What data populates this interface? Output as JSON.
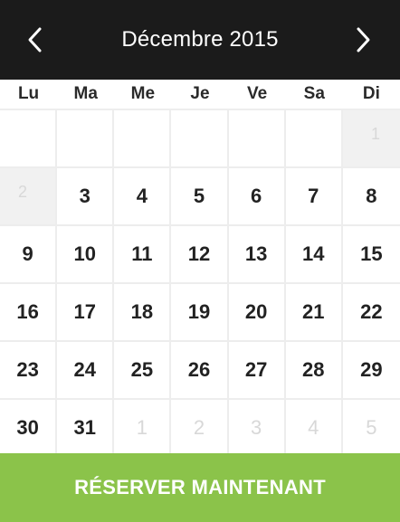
{
  "header": {
    "title": "Décembre 2015",
    "prev_icon": "chevron-left-icon",
    "next_icon": "chevron-right-icon"
  },
  "weekdays": [
    "Lu",
    "Ma",
    "Me",
    "Je",
    "Ve",
    "Sa",
    "Di"
  ],
  "weeks": [
    [
      "",
      "",
      "",
      "",
      "",
      "",
      "1"
    ],
    [
      "2",
      "3",
      "4",
      "5",
      "6",
      "7",
      "8"
    ],
    [
      "9",
      "10",
      "11",
      "12",
      "13",
      "14",
      "15"
    ],
    [
      "16",
      "17",
      "18",
      "19",
      "20",
      "21",
      "22"
    ],
    [
      "23",
      "24",
      "25",
      "26",
      "27",
      "28",
      "29"
    ],
    [
      "30",
      "31",
      "1",
      "2",
      "3",
      "4",
      "5"
    ]
  ],
  "cta": {
    "label": "RÉSERVER MAINTENANT"
  },
  "colors": {
    "header_bg": "#1b1b1b",
    "cta_bg": "#8bc34a",
    "muted_day": "#d8d8d8"
  }
}
